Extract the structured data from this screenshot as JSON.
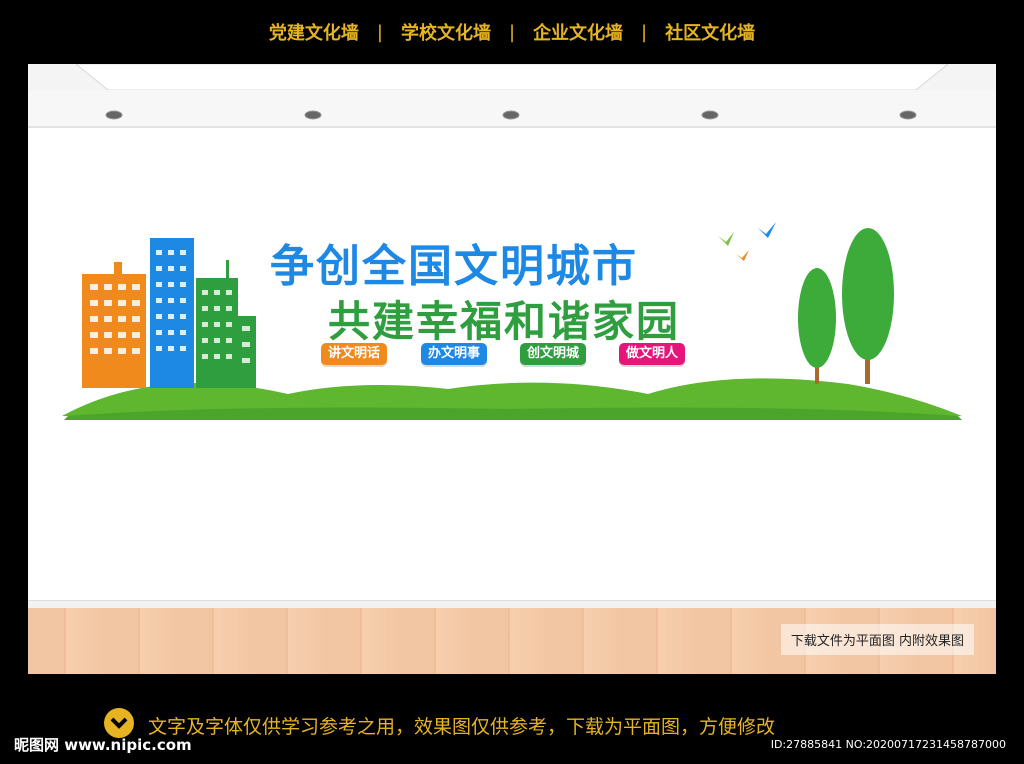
{
  "nav": {
    "items": [
      "党建文化墙",
      "学校文化墙",
      "企业文化墙",
      "社区文化墙"
    ],
    "separator": "|"
  },
  "wall": {
    "title_line1": "争创全国文明城市",
    "title_line2": "共建幸福和谐家园",
    "slogans": [
      {
        "text": "讲文明话",
        "color": "#f08a1c"
      },
      {
        "text": "办文明事",
        "color": "#1e88e5"
      },
      {
        "text": "创文明城",
        "color": "#2e9e3f"
      },
      {
        "text": "做文明人",
        "color": "#e6157a"
      }
    ],
    "floor_note": "下载文件为平面图  内附效果图"
  },
  "footer": {
    "message": "文字及字体仅供学习参考之用，效果图仅供参考，下载为平面图，方便修改",
    "logo": "昵图网 www.nipic.com",
    "id_text": "ID:27885841 NO:20200717231458787000"
  },
  "colors": {
    "accent": "#e6b422",
    "blue": "#1e88e5",
    "green": "#2e9e3f",
    "orange": "#f08a1c",
    "pink": "#e6157a"
  }
}
